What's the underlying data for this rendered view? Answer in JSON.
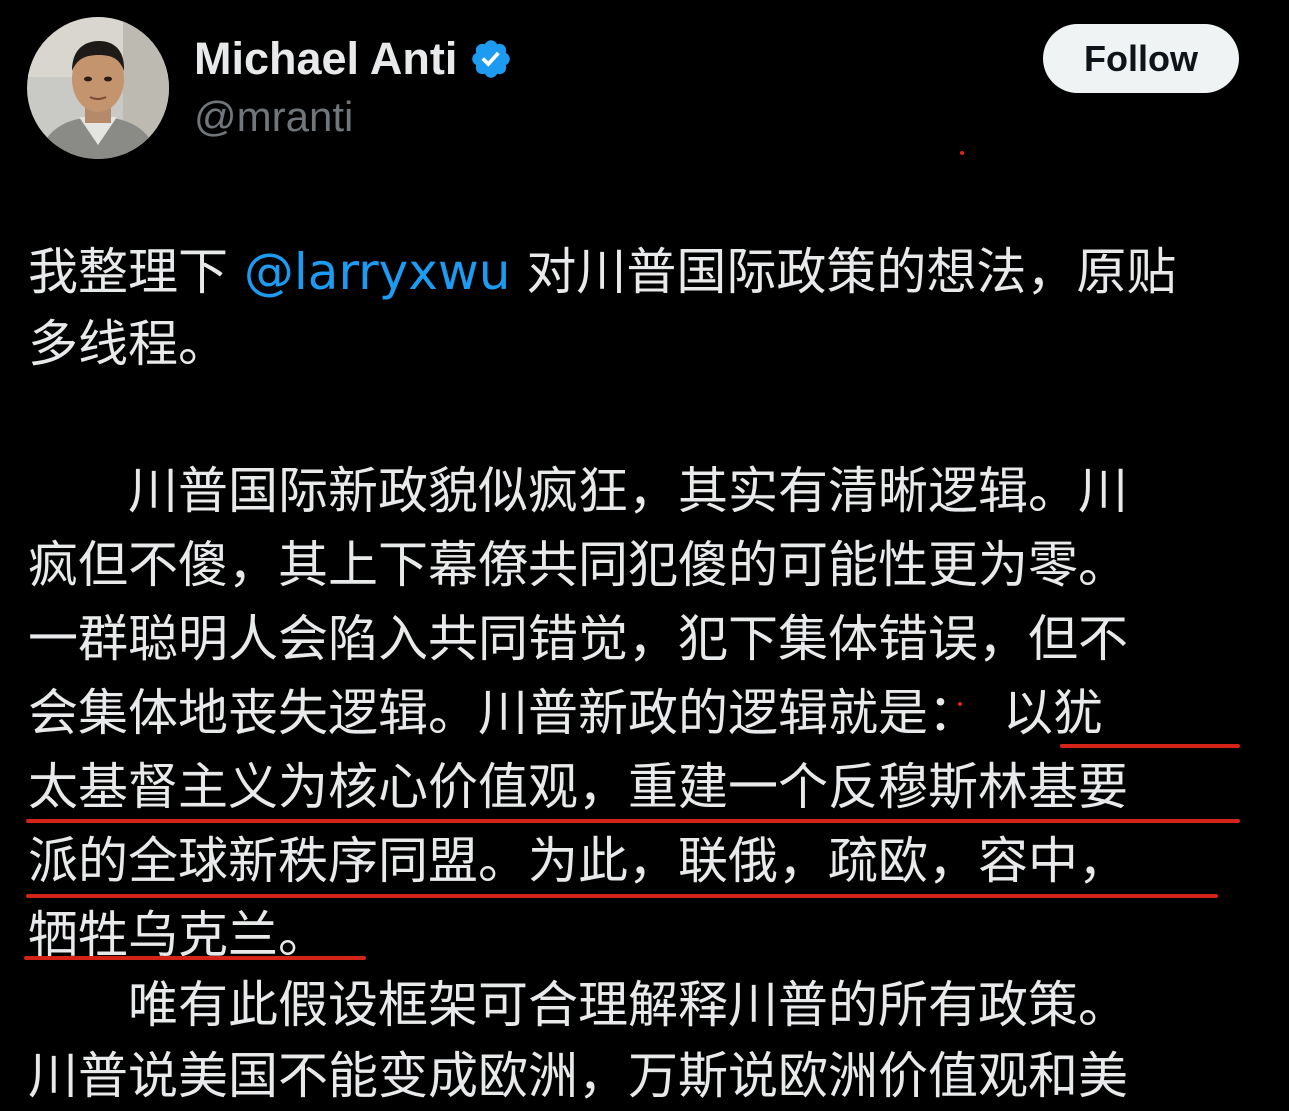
{
  "author": {
    "display_name": "Michael Anti",
    "handle": "@mranti",
    "verified": true,
    "avatar_icon": "profile-photo"
  },
  "follow_button": {
    "label": "Follow"
  },
  "tweet": {
    "intro": {
      "before_mention": "我整理下 ",
      "mention": "@larryxwu",
      "after_mention": " 对川普国际政策的想法，原贴",
      "line2": "多线程。"
    },
    "para1": [
      "　　川普国际新政貌似疯狂，其实有清晰逻辑。川",
      "疯但不傻，其上下幕僚共同犯傻的可能性更为零。",
      "一群聪明人会陷入共同错觉，犯下集体错误，但不",
      "会集体地丧失逻辑。川普新政的逻辑就是：　以犹",
      "太基督主义为核心价值观，重建一个反穆斯林基要",
      "派的全球新秩序同盟。为此，联俄，疏欧，容中，",
      "牺牲乌克兰。"
    ],
    "para2": [
      "　　唯有此假设框架可合理解释川普的所有政策。",
      "川普说美国不能变成欧洲，万斯说欧洲价值观和美"
    ]
  },
  "colors": {
    "background": "#000000",
    "text": "#e7e9ea",
    "secondary": "#71767b",
    "link": "#1d9bf0",
    "verified_badge": "#1d9bf0",
    "follow_bg": "#eff3f4",
    "annotation_red": "#d4241a"
  }
}
